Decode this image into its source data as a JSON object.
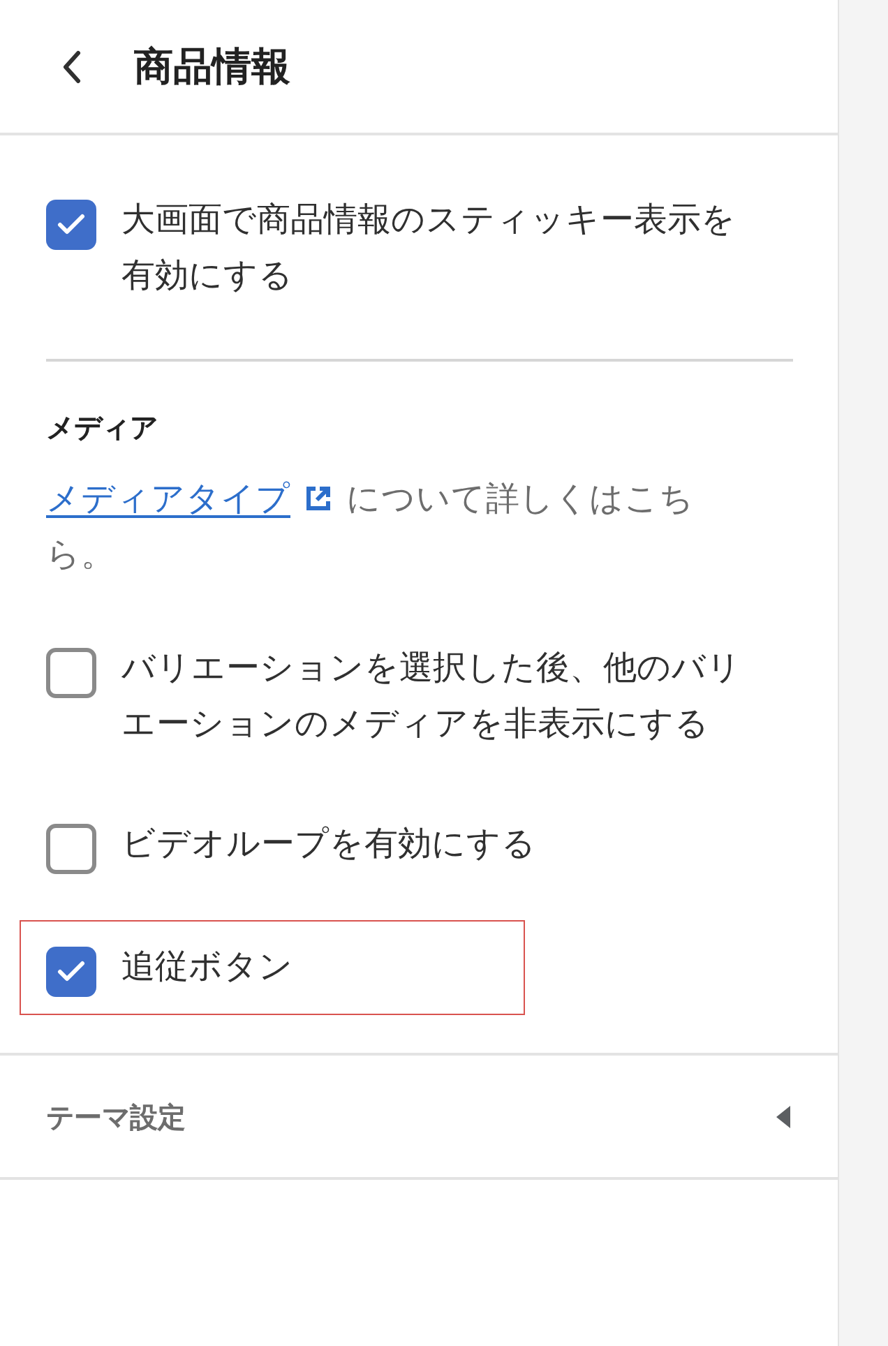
{
  "header": {
    "title": "商品情報"
  },
  "sticky_option": {
    "label": "大画面で商品情報のスティッキー表示を有効にする",
    "checked": true
  },
  "media": {
    "heading": "メディア",
    "link": "メディアタイプ",
    "text": "について詳しくはこちら。"
  },
  "options": [
    {
      "label": "バリエーションを選択した後、他のバリエーションのメディアを非表示にする",
      "checked": false,
      "highlighted": false
    },
    {
      "label": "ビデオループを有効にする",
      "checked": false,
      "highlighted": false
    },
    {
      "label": "追従ボタン",
      "checked": true,
      "highlighted": true
    }
  ],
  "theme_settings": {
    "label": "テーマ設定",
    "expanded": false
  }
}
